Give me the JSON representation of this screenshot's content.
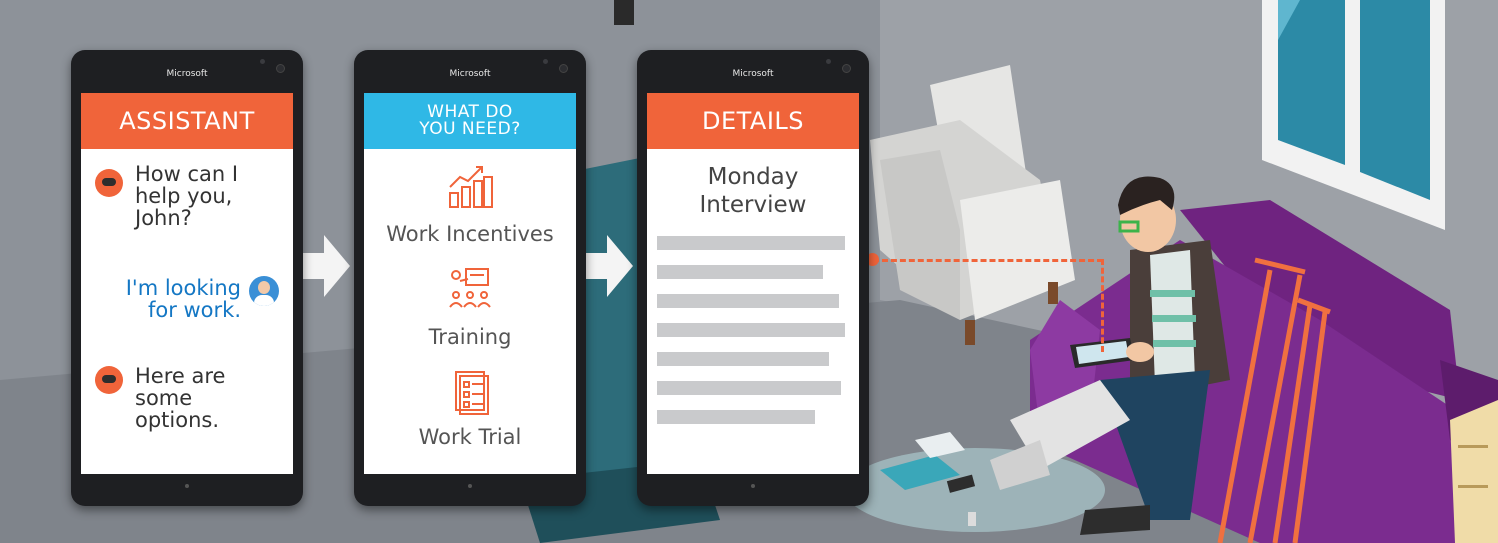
{
  "phones": [
    {
      "brand": "Microsoft",
      "header": "ASSISTANT",
      "header_color": "#f0643a",
      "messages": [
        {
          "from": "assistant",
          "text_lines": [
            "How can I",
            "help you,",
            "John?"
          ]
        },
        {
          "from": "user",
          "text_lines": [
            "I'm looking",
            "for work."
          ]
        },
        {
          "from": "assistant",
          "text_lines": [
            "Here are",
            "some",
            "options."
          ]
        }
      ]
    },
    {
      "brand": "Microsoft",
      "header_lines": [
        "WHAT DO",
        "YOU NEED?"
      ],
      "header_color": "#2fb8e6",
      "options": [
        {
          "label": "Work Incentives",
          "icon": "chart-growth-icon"
        },
        {
          "label": "Training",
          "icon": "training-group-icon"
        },
        {
          "label": "Work Trial",
          "icon": "document-checklist-icon"
        }
      ]
    },
    {
      "brand": "Microsoft",
      "header": "DETAILS",
      "header_color": "#f0643a",
      "title_lines": [
        "Monday",
        "Interview"
      ],
      "placeholder_line_count": 7
    }
  ],
  "colors": {
    "accent_orange": "#f0643a",
    "accent_blue": "#2fb8e6",
    "sofa": "#7b2c8f",
    "wall": "#8a8f96"
  }
}
